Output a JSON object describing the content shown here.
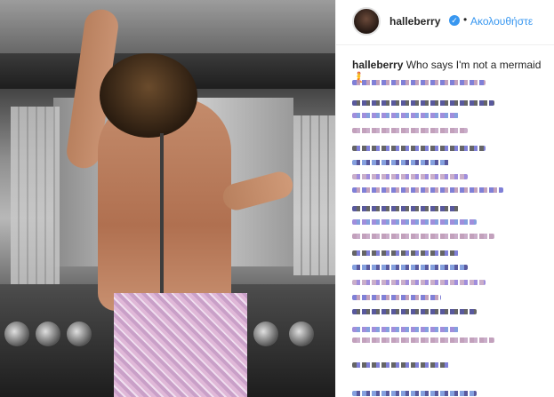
{
  "post": {
    "username": "halleberry",
    "verified_icon": "verified-badge-icon",
    "separator": "•",
    "follow_label": "Ακολουθήστε",
    "caption_user": "halleberry",
    "caption_text": "Who says I'm not a mermaid 🧜",
    "blurred_comment_lines": 20
  },
  "colors": {
    "link": "#3897f0",
    "text": "#262626",
    "border": "#efefef"
  }
}
